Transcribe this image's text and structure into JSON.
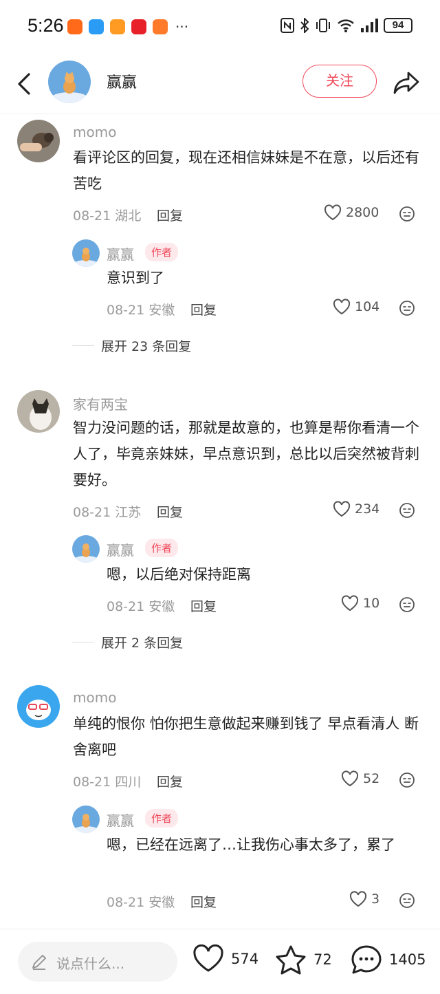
{
  "status_bar": {
    "time": "5:26",
    "dots": "···",
    "battery": "94",
    "app_icons": [
      "taobao-app-icon",
      "message-app-icon",
      "orange-app-icon",
      "red-app-icon",
      "taobao2-app-icon"
    ],
    "status_icons": [
      "nfc-icon",
      "bluetooth-icon",
      "vibrate-icon",
      "wifi-icon",
      "signal-icon"
    ]
  },
  "header": {
    "title": "赢赢",
    "follow_label": "关注"
  },
  "comments": [
    {
      "name": "momo",
      "text": "看评论区的回复，现在还相信妹妹是不在意，以后还有苦吃",
      "date_loc": "08-21 湖北",
      "reply_label": "回复",
      "likes": "2800",
      "reply": {
        "name": "赢赢",
        "badge": "作者",
        "text": "意识到了",
        "date_loc": "08-21 安徽",
        "reply_label": "回复",
        "likes": "104"
      },
      "expand": "展开 23 条回复"
    },
    {
      "name": "家有两宝",
      "text": "智力没问题的话，那就是故意的，也算是帮你看清一个人了，毕竟亲妹妹，早点意识到，总比以后突然被背刺要好。",
      "date_loc": "08-21 江苏",
      "reply_label": "回复",
      "likes": "234",
      "reply": {
        "name": "赢赢",
        "badge": "作者",
        "text": "嗯，以后绝对保持距离",
        "date_loc": "08-21 安徽",
        "reply_label": "回复",
        "likes": "10"
      },
      "expand": "展开 2 条回复"
    },
    {
      "name": "momo",
      "text": "单纯的恨你 怕你把生意做起来赚到钱了 早点看清人 断舍离吧",
      "date_loc": "08-21 四川",
      "reply_label": "回复",
      "likes": "52",
      "reply": {
        "name": "赢赢",
        "badge": "作者",
        "text": "嗯，已经在远离了…让我伤心事太多了，累了",
        "date_loc": "08-21 安徽",
        "reply_label": "回复",
        "likes": "3"
      }
    }
  ],
  "bottom_bar": {
    "input_placeholder": "说点什么...",
    "like_count": "574",
    "star_count": "72",
    "comment_count": "1405"
  },
  "colors": {
    "accent": "#f0485a",
    "badge_bg": "#fde9ec",
    "muted_text": "#9a9a9a"
  }
}
